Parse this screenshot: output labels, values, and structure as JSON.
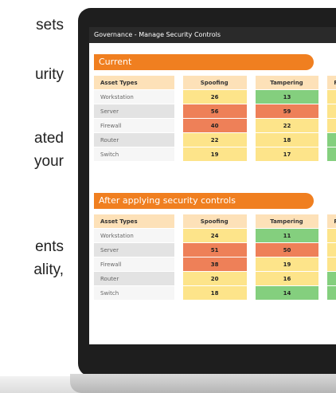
{
  "background_text": [
    "sets",
    "urity",
    "ated",
    "your",
    "ents",
    "ality,"
  ],
  "window": {
    "title": "Governance - Manage Security Controls"
  },
  "sections": [
    {
      "title": "Current",
      "headers": [
        "Asset Types",
        "Spoofing",
        "Tampering",
        "R"
      ],
      "rows": [
        {
          "asset": "Workstation",
          "spoofing": "26",
          "tampering": "13"
        },
        {
          "asset": "Server",
          "spoofing": "56",
          "tampering": "59"
        },
        {
          "asset": "Firewall",
          "spoofing": "40",
          "tampering": "22"
        },
        {
          "asset": "Router",
          "spoofing": "22",
          "tampering": "18"
        },
        {
          "asset": "Switch",
          "spoofing": "19",
          "tampering": "17"
        }
      ]
    },
    {
      "title": "After applying security controls",
      "headers": [
        "Asset Types",
        "Spoofing",
        "Tampering",
        "R"
      ],
      "rows": [
        {
          "asset": "Workstation",
          "spoofing": "24",
          "tampering": "11"
        },
        {
          "asset": "Server",
          "spoofing": "51",
          "tampering": "50"
        },
        {
          "asset": "Firewall",
          "spoofing": "38",
          "tampering": "19"
        },
        {
          "asset": "Router",
          "spoofing": "20",
          "tampering": "16"
        },
        {
          "asset": "Switch",
          "spoofing": "18",
          "tampering": "14"
        }
      ]
    }
  ],
  "colors": {
    "accent": "#f07f20",
    "yellow": "#fde48a",
    "red": "#ee8058",
    "green": "#84cf7e"
  }
}
